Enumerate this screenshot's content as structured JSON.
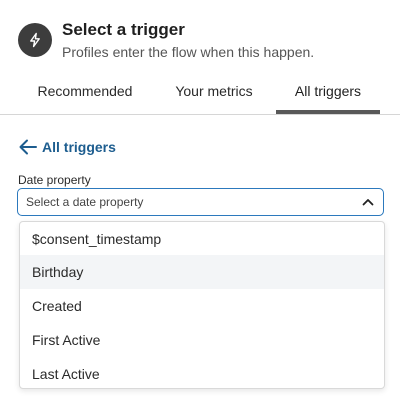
{
  "header": {
    "title": "Select a trigger",
    "subtitle": "Profiles enter the flow when this happen.",
    "icon": "lightning-icon"
  },
  "tabs": [
    {
      "label": "Recommended",
      "active": false
    },
    {
      "label": "Your metrics",
      "active": false
    },
    {
      "label": "All triggers",
      "active": true
    }
  ],
  "back_link": {
    "label": "All triggers",
    "icon": "arrow-left-icon"
  },
  "date_field": {
    "label": "Date property",
    "placeholder": "Select a date property",
    "icon": "chevron-up-icon",
    "options": [
      {
        "label": "$consent_timestamp",
        "highlighted": false
      },
      {
        "label": "Birthday",
        "highlighted": true
      },
      {
        "label": "Created",
        "highlighted": false
      },
      {
        "label": "First Active",
        "highlighted": false
      },
      {
        "label": "Last Active",
        "highlighted": false
      }
    ]
  },
  "colors": {
    "accent": "#2c79bd",
    "link": "#1d5d8f",
    "icon_bg": "#3d3d3d",
    "highlight": "#f3f5f7"
  }
}
